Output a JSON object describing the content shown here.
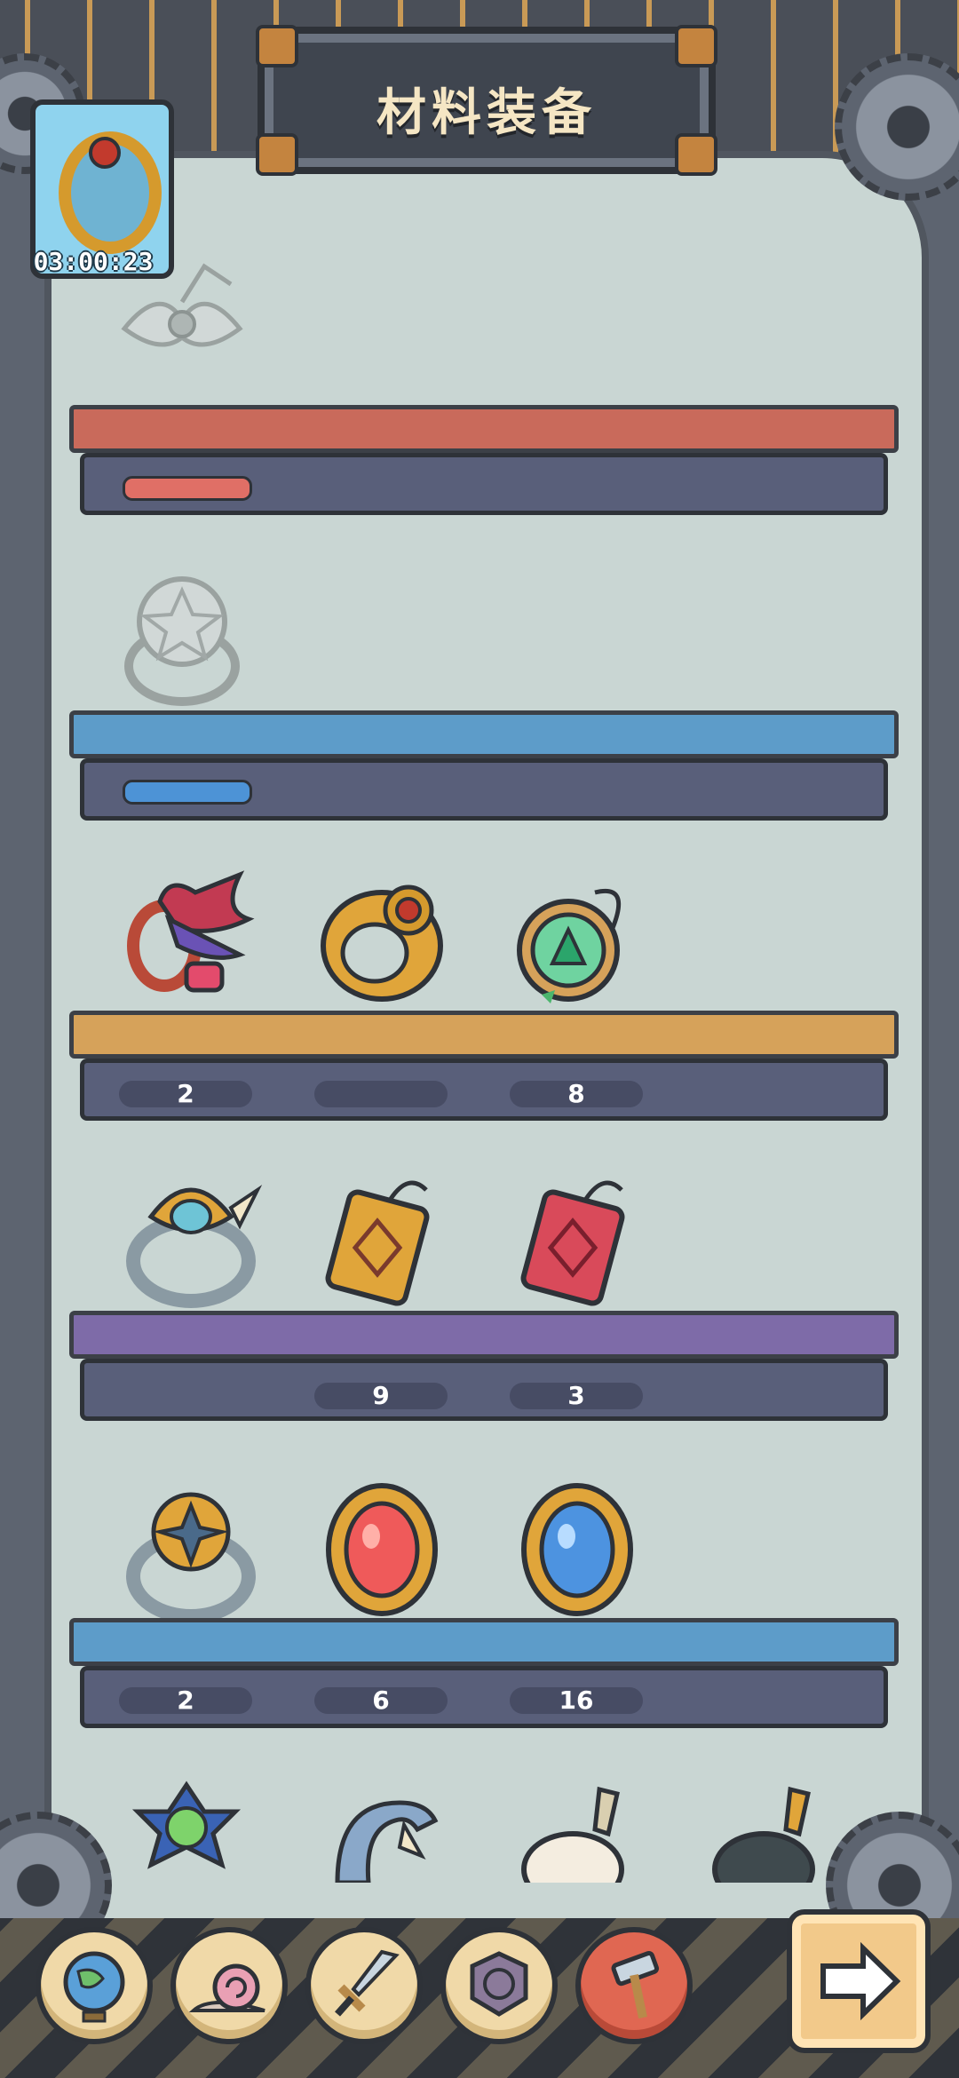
{
  "header": {
    "title": "材料装备"
  },
  "featured": {
    "icon": "gold-ruby-ring-icon",
    "timer": "03:00:23"
  },
  "shelves": [
    {
      "color": "#c96a5b",
      "items": [
        {
          "icon": "winged-eye-amulet-icon",
          "locked": true
        }
      ]
    },
    {
      "color": "#5d9cc9",
      "items": [
        {
          "icon": "silver-star-ring-icon",
          "locked": true
        }
      ]
    },
    {
      "color": "#d6a25a",
      "items": [
        {
          "icon": "winged-feather-ring-icon",
          "count": "2"
        },
        {
          "icon": "gold-ruby-ring-icon",
          "count": ""
        },
        {
          "icon": "green-compass-amulet-icon",
          "count": "8"
        }
      ]
    },
    {
      "color": "#7e6ba8",
      "items": [
        {
          "icon": "horned-silver-ring-icon",
          "count": ""
        },
        {
          "icon": "gold-rune-pendant-icon",
          "count": "9"
        },
        {
          "icon": "red-rune-pendant-icon",
          "count": "3"
        }
      ]
    },
    {
      "color": "#5d9cc9",
      "items": [
        {
          "icon": "clover-gem-ring-icon",
          "count": "2"
        },
        {
          "icon": "ruby-gold-brooch-icon",
          "count": "6"
        },
        {
          "icon": "sapphire-gold-brooch-icon",
          "count": "16"
        }
      ]
    },
    {
      "color": "#c9d6d3",
      "items": [
        {
          "icon": "flower-gem-ring-icon"
        },
        {
          "icon": "claw-ring-icon"
        },
        {
          "icon": "pearl-earring-icon"
        },
        {
          "icon": "black-pearl-earring-icon"
        }
      ]
    }
  ],
  "nav": {
    "items": [
      {
        "icon": "globe-icon"
      },
      {
        "icon": "snail-icon"
      },
      {
        "icon": "sword-icon"
      },
      {
        "icon": "spiral-shield-icon"
      },
      {
        "icon": "hammer-icon",
        "active": true
      }
    ],
    "next_icon": "arrow-right-icon"
  }
}
